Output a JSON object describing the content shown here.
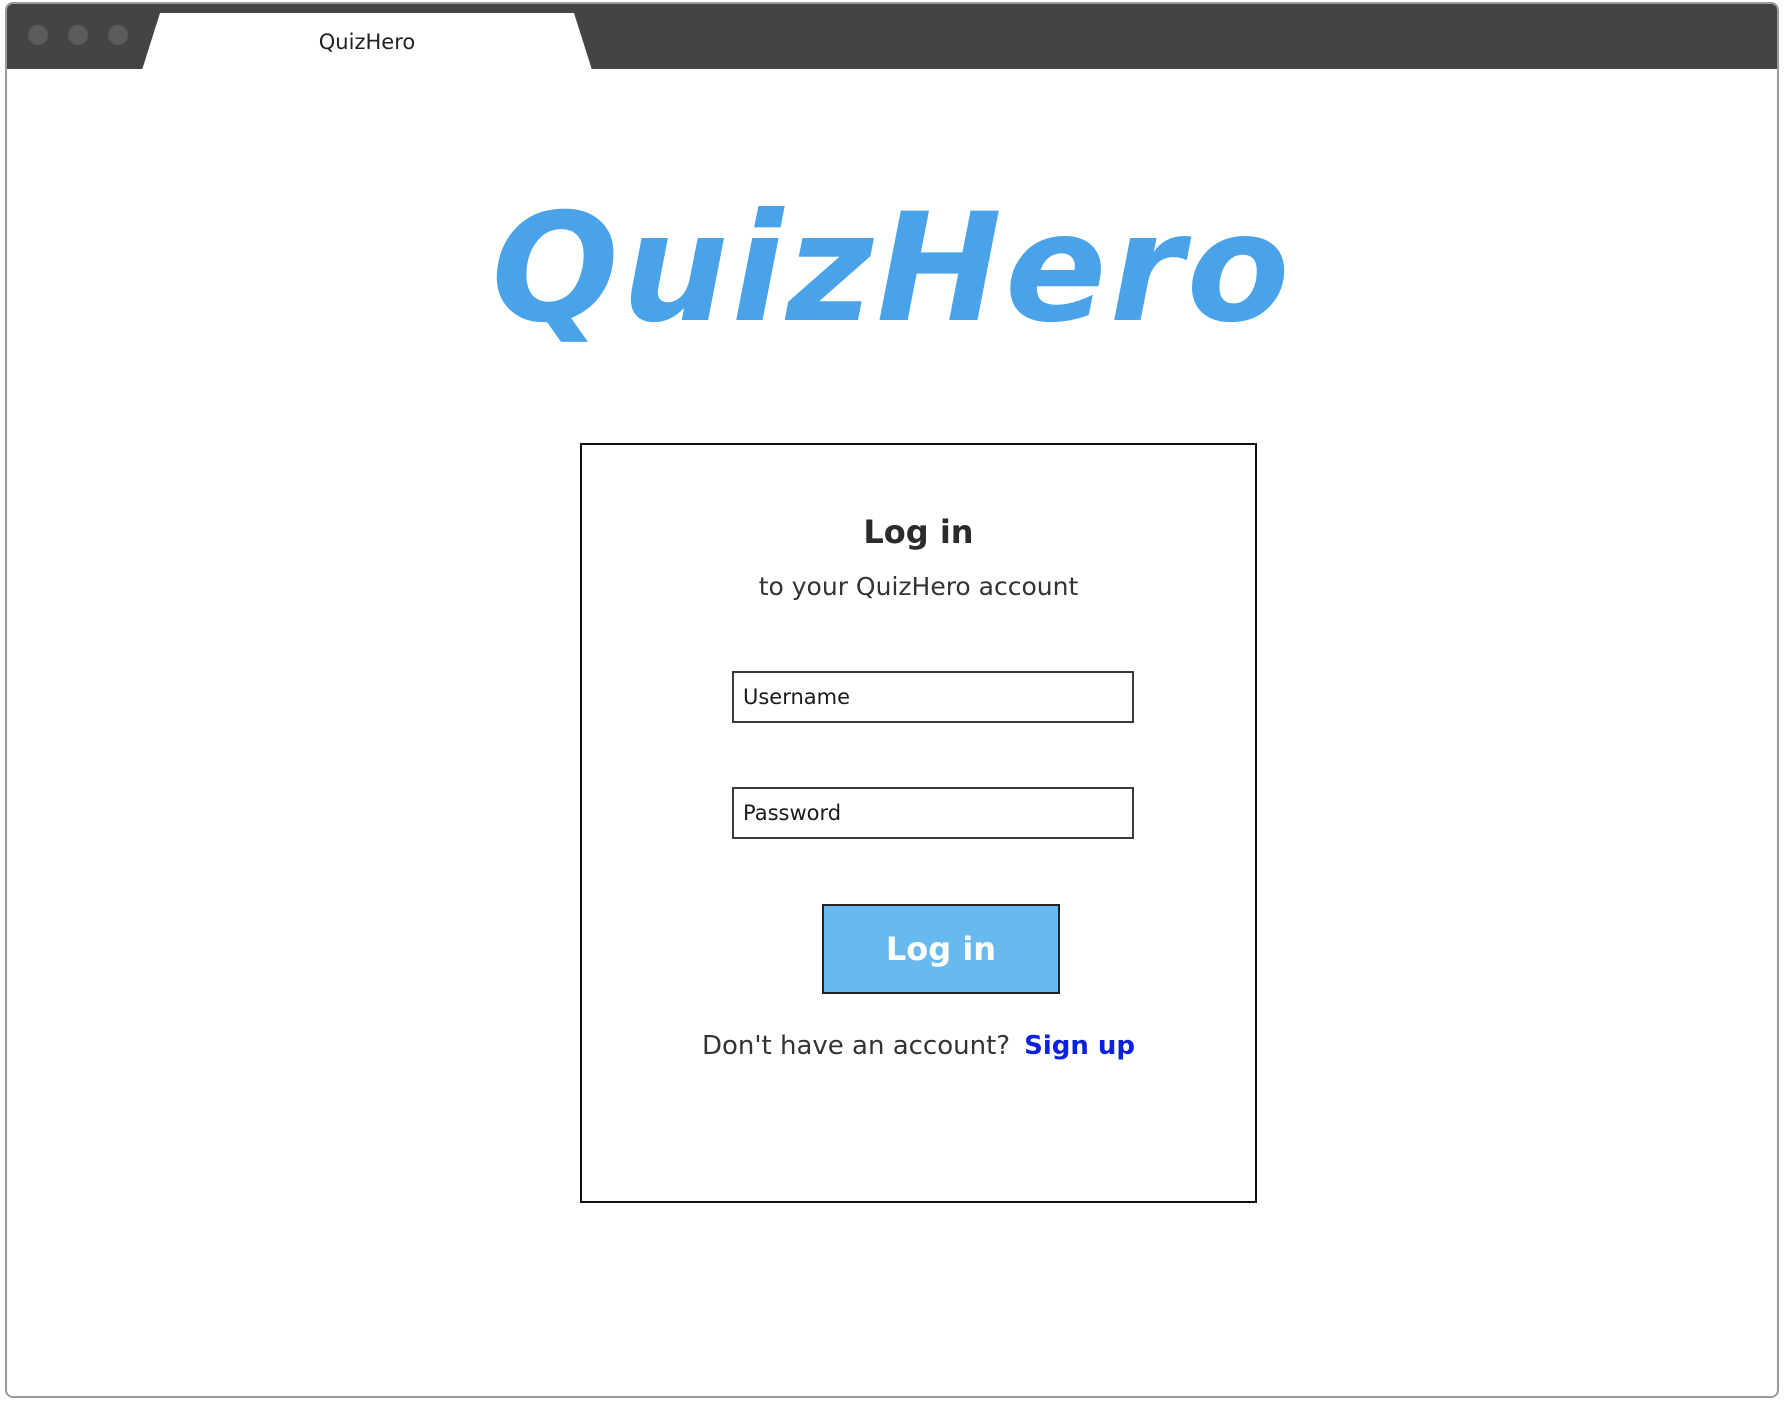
{
  "browser": {
    "tab_title": "QuizHero",
    "window_controls": [
      "close-dot",
      "minimize-dot",
      "maximize-dot"
    ]
  },
  "logo": {
    "text": "QuizHero",
    "color": "#4aa3e8"
  },
  "login_card": {
    "title": "Log in",
    "subtitle": "to your QuizHero account",
    "username_placeholder": "Username",
    "password_placeholder": "Password",
    "button_label": "Log in",
    "signup_prompt": "Don't have an account?",
    "signup_link": "Sign up"
  },
  "colors": {
    "titlebar": "#444444",
    "accent": "#67b9ee",
    "link": "#0a22e0"
  }
}
